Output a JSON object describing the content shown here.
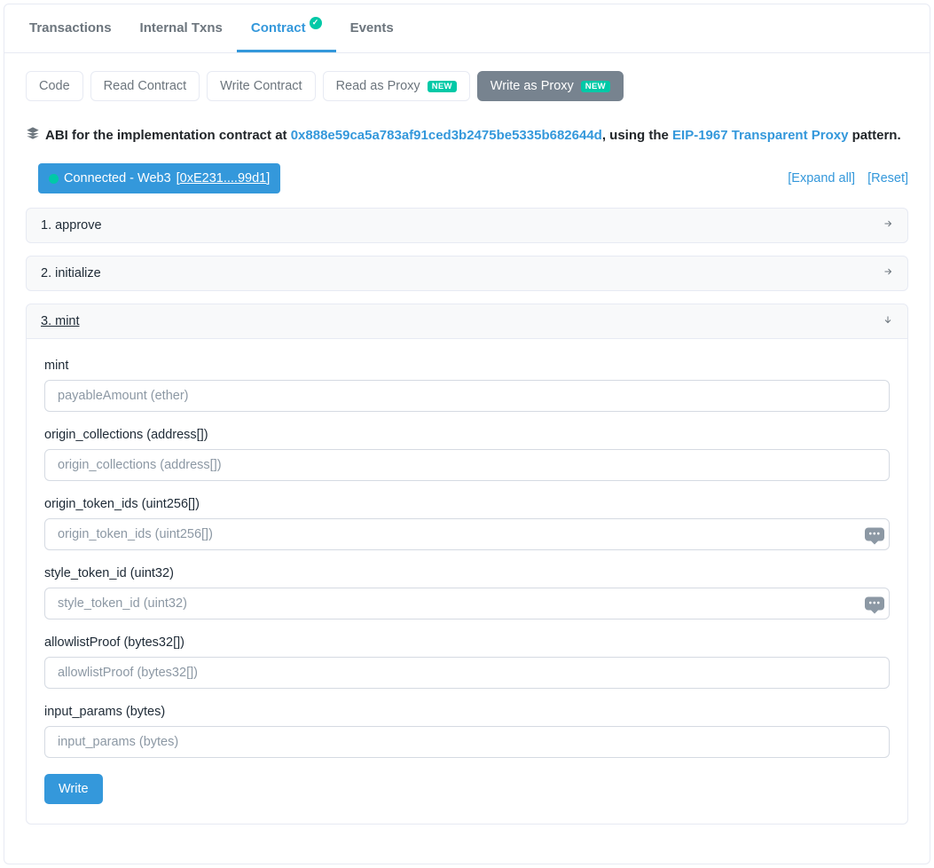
{
  "tabs": {
    "transactions": "Transactions",
    "internal": "Internal Txns",
    "contract": "Contract",
    "events": "Events"
  },
  "subtabs": {
    "code": "Code",
    "read": "Read Contract",
    "write": "Write Contract",
    "readProxy": "Read as Proxy",
    "writeProxy": "Write as Proxy",
    "newBadge": "NEW"
  },
  "abi": {
    "prefix": "ABI for the implementation contract at ",
    "address": "0x888e59ca5a783af91ced3b2475be5335b682644d",
    "mid": ", using the ",
    "proxyLink": "EIP-1967 Transparent Proxy",
    "suffix": " pattern."
  },
  "status": {
    "connected": "Connected - Web3 ",
    "short": "[0xE231....99d1]",
    "expand": "[Expand all]",
    "reset": "[Reset]"
  },
  "functions": {
    "approve": "1. approve",
    "initialize": "2. initialize",
    "mint": "3. mint"
  },
  "mintForm": {
    "title": "mint",
    "payable": {
      "placeholder": "payableAmount (ether)"
    },
    "origin_collections": {
      "label": "origin_collections (address[])",
      "placeholder": "origin_collections (address[])"
    },
    "origin_token_ids": {
      "label": "origin_token_ids (uint256[])",
      "placeholder": "origin_token_ids (uint256[])"
    },
    "style_token_id": {
      "label": "style_token_id (uint32)",
      "placeholder": "style_token_id (uint32)"
    },
    "allowlistProof": {
      "label": "allowlistProof (bytes32[])",
      "placeholder": "allowlistProof (bytes32[])"
    },
    "input_params": {
      "label": "input_params (bytes)",
      "placeholder": "input_params (bytes)"
    },
    "writeBtn": "Write"
  }
}
